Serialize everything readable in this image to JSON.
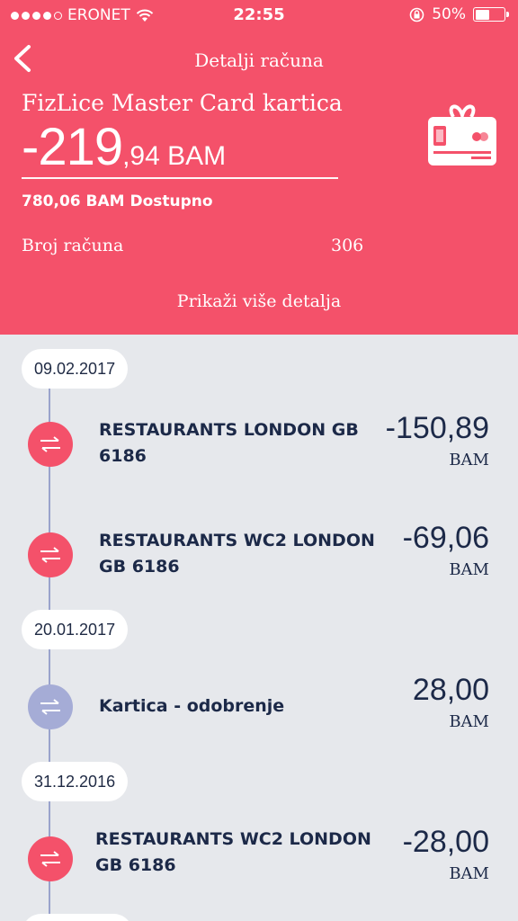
{
  "status_bar": {
    "carrier": "ERONET",
    "time": "22:55",
    "battery": "50%",
    "battery_level": 0.5
  },
  "nav": {
    "title": "Detalji računa"
  },
  "account": {
    "name": "FizLice Master Card kartica",
    "balance_int": "-219",
    "balance_dec": ",94 BAM",
    "available": "780,06 BAM Dostupno",
    "number_label": "Broj računa",
    "number_value": "306",
    "more_details": "Prikaži više detalja"
  },
  "colors": {
    "accent": "#f4516a",
    "timeline": "#9aa3cc",
    "text_dark": "#1c2948",
    "credit": "#a5acd6"
  },
  "timeline": {
    "dates": [
      "09.02.2017",
      "20.01.2017",
      "31.12.2016"
    ],
    "transactions": [
      {
        "title_line1": "RESTAURANTS LONDON GB",
        "title_line2": "6186",
        "amount": "-150,89",
        "currency": "BAM",
        "icon": "transfer-arrows-icon"
      },
      {
        "title_line1": "RESTAURANTS WC2 LONDON",
        "title_line2": "GB 6186",
        "amount": "-69,06",
        "currency": "BAM",
        "icon": "transfer-arrows-icon"
      },
      {
        "title_line1": "Kartica - odobrenje",
        "title_line2": "",
        "amount": "28,00",
        "currency": "BAM",
        "icon": "transfer-arrows-icon"
      },
      {
        "title_line1": "RESTAURANTS WC2 LONDON",
        "title_line2": "GB 6186",
        "amount": "-28,00",
        "currency": "BAM",
        "icon": "transfer-arrows-icon"
      }
    ]
  }
}
